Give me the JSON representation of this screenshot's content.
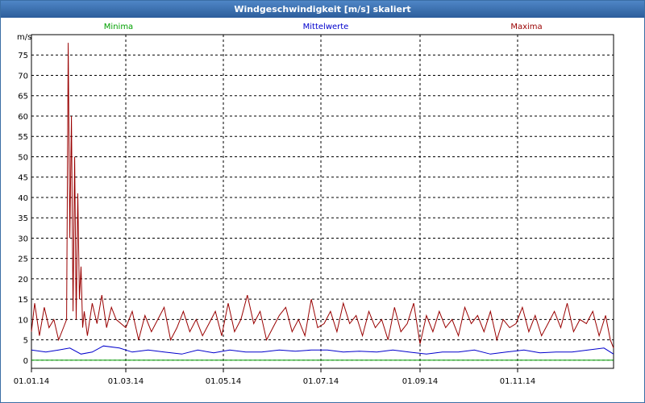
{
  "window": {
    "title": "Windgeschwindigkeit [m/s] skaliert"
  },
  "colors": {
    "min": "#00a000",
    "mean": "#0000cc",
    "max": "#990000",
    "grid": "#000000",
    "titlebar": "#2f62a6"
  },
  "chart_data": {
    "type": "line",
    "title": "Windgeschwindigkeit [m/s] skaliert",
    "ylabel": "m/s",
    "ylim": [
      -2,
      80
    ],
    "xlim": [
      "2014-01-01",
      "2014-12-31"
    ],
    "yticks": [
      "0",
      "5",
      "10",
      "15",
      "20",
      "25",
      "30",
      "35",
      "40",
      "45",
      "50",
      "55",
      "60",
      "65",
      "70",
      "75"
    ],
    "xticks": [
      {
        "date": "2014-01-01",
        "label": "01.01.14"
      },
      {
        "date": "2014-03-01",
        "label": "01.03.14"
      },
      {
        "date": "2014-05-01",
        "label": "01.05.14"
      },
      {
        "date": "2014-07-01",
        "label": "01.07.14"
      },
      {
        "date": "2014-09-01",
        "label": "01.09.14"
      },
      {
        "date": "2014-11-01",
        "label": "01.11.14"
      }
    ],
    "grid": true,
    "series": [
      {
        "name": "Minima",
        "color": "#00a000",
        "x": [
          "2014-01-01",
          "2014-02-01",
          "2014-03-01",
          "2014-04-01",
          "2014-05-01",
          "2014-06-01",
          "2014-07-01",
          "2014-08-01",
          "2014-09-01",
          "2014-10-01",
          "2014-11-01",
          "2014-12-01",
          "2014-12-31"
        ],
        "y": [
          0,
          0,
          0,
          0,
          0,
          0,
          0,
          0,
          0,
          0,
          0,
          0,
          0
        ]
      },
      {
        "name": "Mittelwerte",
        "color": "#0000cc",
        "x": [
          "2014-01-01",
          "2014-01-10",
          "2014-01-18",
          "2014-01-25",
          "2014-02-01",
          "2014-02-08",
          "2014-02-15",
          "2014-02-25",
          "2014-03-05",
          "2014-03-15",
          "2014-03-25",
          "2014-04-05",
          "2014-04-15",
          "2014-04-25",
          "2014-05-05",
          "2014-05-15",
          "2014-05-25",
          "2014-06-05",
          "2014-06-15",
          "2014-06-25",
          "2014-07-05",
          "2014-07-15",
          "2014-07-25",
          "2014-08-05",
          "2014-08-15",
          "2014-08-25",
          "2014-09-05",
          "2014-09-15",
          "2014-09-25",
          "2014-10-05",
          "2014-10-15",
          "2014-10-25",
          "2014-11-05",
          "2014-11-15",
          "2014-11-25",
          "2014-12-05",
          "2014-12-15",
          "2014-12-25",
          "2014-12-31"
        ],
        "y": [
          2.5,
          2,
          2.5,
          3,
          1.5,
          2,
          3.5,
          3,
          2,
          2.5,
          2,
          1.5,
          2.5,
          1.8,
          2.5,
          2,
          2,
          2.5,
          2.2,
          2.5,
          2.5,
          2,
          2.2,
          2,
          2.5,
          2,
          1.5,
          2,
          2,
          2.5,
          1.5,
          2,
          2.5,
          1.8,
          2,
          2,
          2.5,
          3,
          1.5
        ]
      },
      {
        "name": "Maxima",
        "color": "#990000",
        "x": [
          "2014-01-01",
          "2014-01-03",
          "2014-01-06",
          "2014-01-09",
          "2014-01-12",
          "2014-01-15",
          "2014-01-18",
          "2014-01-21",
          "2014-01-23",
          "2014-01-24",
          "2014-01-25",
          "2014-01-26",
          "2014-01-27",
          "2014-01-28",
          "2014-01-29",
          "2014-01-30",
          "2014-01-31",
          "2014-02-01",
          "2014-02-02",
          "2014-02-03",
          "2014-02-05",
          "2014-02-08",
          "2014-02-11",
          "2014-02-14",
          "2014-02-17",
          "2014-02-20",
          "2014-02-23",
          "2014-02-26",
          "2014-03-01",
          "2014-03-05",
          "2014-03-09",
          "2014-03-13",
          "2014-03-17",
          "2014-03-21",
          "2014-03-25",
          "2014-03-29",
          "2014-04-02",
          "2014-04-06",
          "2014-04-10",
          "2014-04-14",
          "2014-04-18",
          "2014-04-22",
          "2014-04-26",
          "2014-04-30",
          "2014-05-04",
          "2014-05-08",
          "2014-05-12",
          "2014-05-16",
          "2014-05-20",
          "2014-05-24",
          "2014-05-28",
          "2014-06-01",
          "2014-06-05",
          "2014-06-09",
          "2014-06-13",
          "2014-06-17",
          "2014-06-21",
          "2014-06-25",
          "2014-06-29",
          "2014-07-03",
          "2014-07-07",
          "2014-07-11",
          "2014-07-15",
          "2014-07-19",
          "2014-07-23",
          "2014-07-27",
          "2014-07-31",
          "2014-08-04",
          "2014-08-08",
          "2014-08-12",
          "2014-08-16",
          "2014-08-20",
          "2014-08-24",
          "2014-08-28",
          "2014-09-01",
          "2014-09-05",
          "2014-09-09",
          "2014-09-13",
          "2014-09-17",
          "2014-09-21",
          "2014-09-25",
          "2014-09-29",
          "2014-10-03",
          "2014-10-07",
          "2014-10-11",
          "2014-10-15",
          "2014-10-19",
          "2014-10-23",
          "2014-10-27",
          "2014-10-31",
          "2014-11-04",
          "2014-11-08",
          "2014-11-12",
          "2014-11-16",
          "2014-11-20",
          "2014-11-24",
          "2014-11-28",
          "2014-12-02",
          "2014-12-06",
          "2014-12-10",
          "2014-12-14",
          "2014-12-18",
          "2014-12-22",
          "2014-12-26",
          "2014-12-29",
          "2014-12-31"
        ],
        "y": [
          7,
          14,
          6,
          13,
          8,
          10,
          5,
          8,
          10,
          78,
          30,
          60,
          12,
          50,
          10,
          41,
          15,
          23,
          8,
          12,
          6,
          14,
          9,
          16,
          8,
          13,
          10,
          9,
          8,
          12,
          5,
          11,
          7,
          10,
          13,
          5,
          8,
          12,
          7,
          10,
          6,
          9,
          12,
          6,
          14,
          7,
          10,
          16,
          9,
          12,
          5,
          8,
          11,
          13,
          7,
          10,
          6,
          15,
          8,
          9,
          12,
          7,
          14,
          9,
          11,
          6,
          12,
          8,
          10,
          5,
          13,
          7,
          9,
          14,
          4,
          11,
          7,
          12,
          8,
          10,
          6,
          13,
          9,
          11,
          7,
          12,
          5,
          10,
          8,
          9,
          13,
          7,
          11,
          6,
          9,
          12,
          8,
          14,
          7,
          10,
          9,
          12,
          6,
          11,
          5,
          3
        ]
      }
    ]
  }
}
